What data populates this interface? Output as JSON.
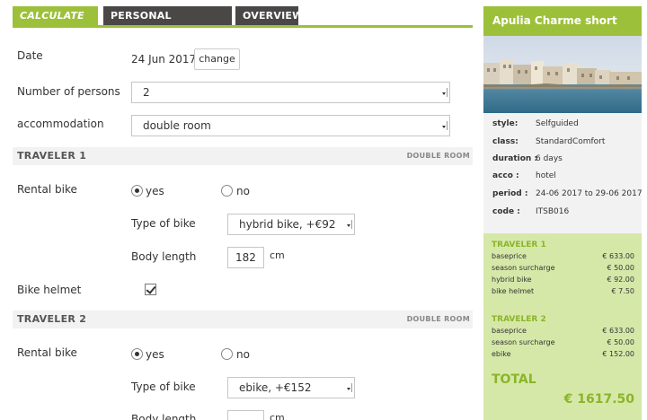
{
  "tabs": [
    {
      "label": "CALCULATE PRICE",
      "active": true
    },
    {
      "label": "PERSONAL INFORMATION",
      "active": false
    },
    {
      "label": "OVERVIEW",
      "active": false
    }
  ],
  "form": {
    "date_label": "Date",
    "date_value": "24 Jun 2017",
    "change_label": "change",
    "persons_label": "Number of persons",
    "persons_value": "2",
    "accommodation_label": "accommodation",
    "accommodation_value": "double room"
  },
  "travelers": [
    {
      "title": "TRAVELER 1",
      "room": "DOUBLE ROOM",
      "rental_bike_label": "Rental bike",
      "yes_label": "yes",
      "no_label": "no",
      "rental_bike": "yes",
      "bike_type_label": "Type of bike",
      "bike_type_value": "hybrid bike, +€92",
      "body_length_label": "Body length",
      "body_length_value": "182",
      "unit": "cm",
      "helmet_label": "Bike helmet",
      "helmet_checked": true
    },
    {
      "title": "TRAVELER 2",
      "room": "DOUBLE ROOM",
      "rental_bike_label": "Rental bike",
      "yes_label": "yes",
      "no_label": "no",
      "rental_bike": "yes",
      "bike_type_label": "Type of bike",
      "bike_type_value": "ebike, +€152",
      "body_length_label": "Body length",
      "body_length_value": "",
      "unit": "cm"
    }
  ],
  "sidebar": {
    "title": "Apulia Charme short break",
    "details": [
      {
        "key": "style:",
        "value": "Selfguided"
      },
      {
        "key": "class:",
        "value": "StandardComfort"
      },
      {
        "key": "duration :",
        "value": "6 days"
      },
      {
        "key": "acco :",
        "value": "hotel"
      },
      {
        "key": "period :",
        "value": "24-06 2017 to 29-06 2017"
      },
      {
        "key": "code :",
        "value": "ITSB016"
      }
    ],
    "price_groups": [
      {
        "title": "TRAVELER 1",
        "items": [
          {
            "label": "baseprice",
            "amount": "€ 633.00"
          },
          {
            "label": "season surcharge",
            "amount": "€ 50.00"
          },
          {
            "label": "hybrid bike",
            "amount": "€ 92.00"
          },
          {
            "label": "bike helmet",
            "amount": "€ 7.50"
          }
        ]
      },
      {
        "title": "TRAVELER 2",
        "items": [
          {
            "label": "baseprice",
            "amount": "€ 633.00"
          },
          {
            "label": "season surcharge",
            "amount": "€ 50.00"
          },
          {
            "label": "ebike",
            "amount": "€ 152.00"
          }
        ]
      }
    ],
    "total_label": "TOTAL",
    "total_value": "€ 1617.50"
  },
  "colors": {
    "accent": "#9dc03a",
    "tab_dark": "#4a4747",
    "price_box": "#d6e8a8"
  }
}
